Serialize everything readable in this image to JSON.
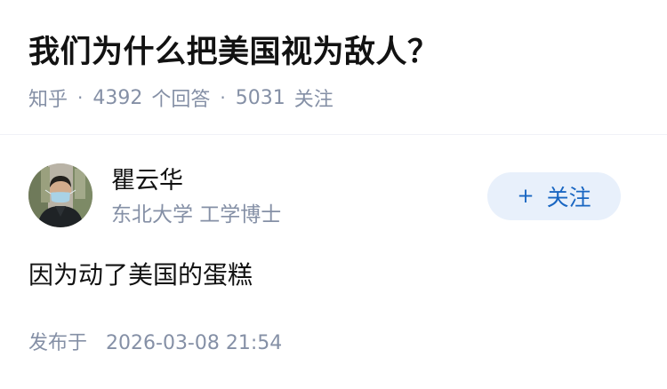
{
  "question": {
    "title": "我们为什么把美国视为敌人？",
    "source": "知乎",
    "separator": "·",
    "answer_count": "4392",
    "answer_count_label": "个回答",
    "follower_count": "5031",
    "follower_count_label": "关注"
  },
  "answer": {
    "author": {
      "name": "瞿云华",
      "headline": "东北大学 工学博士",
      "avatar": "person-photo"
    },
    "follow_button": {
      "icon": "+",
      "label": "关注"
    },
    "content": "因为动了美国的蛋糕",
    "published_label": "发布于",
    "published_time": "2026-03-08 21:54"
  },
  "colors": {
    "title": "#121212",
    "meta": "#8590a6",
    "accent": "#1966c2",
    "button_bg": "#e8f0fb",
    "divider": "#f0f2f7"
  }
}
